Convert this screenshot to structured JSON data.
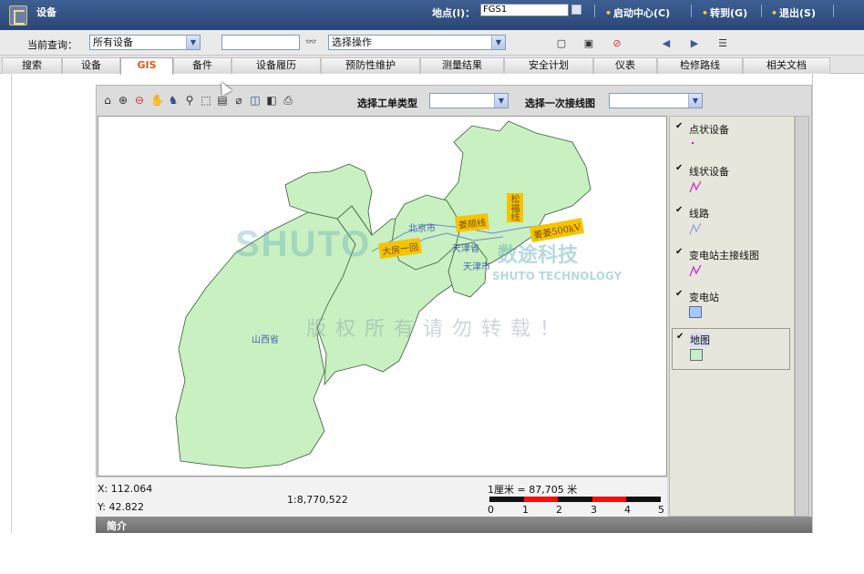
{
  "topbar": {
    "title": "设备",
    "location_label": "地点(I)：",
    "location_value": "FGS1",
    "links": [
      {
        "label": "启动中心(C)"
      },
      {
        "label": "转到(G)"
      },
      {
        "label": "退出(S)"
      }
    ]
  },
  "query": {
    "label": "当前查询：",
    "selected": "所有设备",
    "search_value": "",
    "action_selected": "选择操作"
  },
  "tabs": [
    "搜索",
    "设备",
    "GIS",
    "备件",
    "设备履历",
    "预防性维护",
    "测量结果",
    "安全计划",
    "仪表",
    "检修路线",
    "相关文档"
  ],
  "active_tab": "GIS",
  "gis": {
    "workorder_type_label": "选择工单类型",
    "diagram_label": "选择一次接线图",
    "map_labels": {
      "beijing": "北京市",
      "tianjin": "天津市",
      "shanxi": "山西省",
      "tianjin_top": "天津省",
      "datang": "大房一回",
      "jiangnan": "姜顺线",
      "songdian": "松福线",
      "jiangkv": "姜姜500kV"
    },
    "watermark": {
      "logo": "SHUTO",
      "cn_company": "数途科技",
      "en_company": "SHUTO TECHNOLOGY",
      "rights": "版权所有请勿转载！"
    },
    "legend": [
      {
        "label": "点状设备",
        "checked": true,
        "symbol": "point"
      },
      {
        "label": "线状设备",
        "checked": true,
        "symbol": "line-magenta"
      },
      {
        "label": "线路",
        "checked": true,
        "symbol": "line-blue"
      },
      {
        "label": "变电站主接线图",
        "checked": true,
        "symbol": "line-magenta"
      },
      {
        "label": "变电站",
        "checked": true,
        "symbol": "box-blue"
      },
      {
        "label": "地图",
        "checked": true,
        "symbol": "box-green"
      }
    ],
    "colors": {
      "land": "#c8f0c0",
      "box_blue": "#a8c8f8",
      "box_green": "#c8f0c0",
      "tag": "#f5c400"
    },
    "status": {
      "x": "X: 112.064",
      "y": "Y: 42.822",
      "scale_ratio": "1:8,770,522",
      "scale_caption": "1厘米 = 87,705 米",
      "scale_ticks": [
        "0",
        "1",
        "2",
        "3",
        "4",
        "5"
      ]
    },
    "bottom_label": "简介"
  }
}
